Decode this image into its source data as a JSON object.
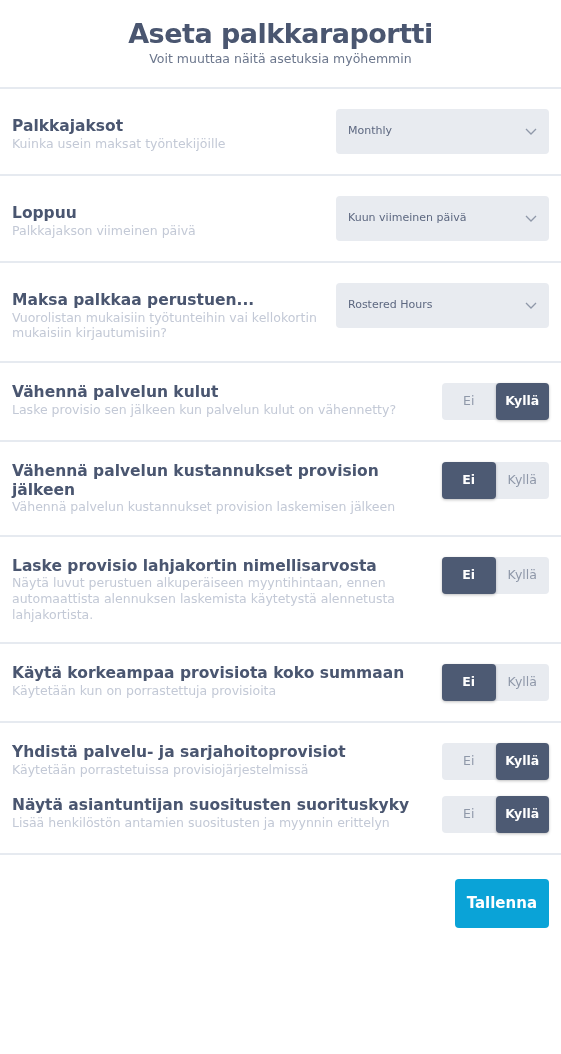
{
  "header": {
    "title": "Aseta palkkaraportti",
    "subtitle": "Voit muuttaa näitä asetuksia myöhemmin"
  },
  "sections": [
    {
      "settings": [
        {
          "kind": "select",
          "title": "Palkkajaksot",
          "description": "Kuinka usein maksat työntekijöille",
          "value": "Monthly"
        }
      ]
    },
    {
      "settings": [
        {
          "kind": "select",
          "title": "Loppuu",
          "description": "Palkkajakson viimeinen päivä",
          "value": "Kuun viimeinen päivä"
        }
      ]
    },
    {
      "settings": [
        {
          "kind": "select",
          "title": "Maksa palkkaa perustuen...",
          "description": "Vuorolistan mukaisiin työtunteihin vai kellokortin mukaisiin kirjautumisiin?",
          "value": "Rostered Hours"
        }
      ]
    },
    {
      "settings": [
        {
          "kind": "toggle",
          "title": "Vähennä palvelun kulut",
          "description": "Laske provisio sen jälkeen kun palvelun kulut on vähennetty?",
          "options": [
            {
              "label": "Ei",
              "selected": false
            },
            {
              "label": "Kyllä",
              "selected": true
            }
          ]
        }
      ]
    },
    {
      "settings": [
        {
          "kind": "toggle",
          "title": "Vähennä palvelun kustannukset provision jälkeen",
          "description": "Vähennä palvelun kustannukset provision laskemisen jälkeen",
          "options": [
            {
              "label": "Ei",
              "selected": true
            },
            {
              "label": "Kyllä",
              "selected": false
            }
          ]
        }
      ]
    },
    {
      "settings": [
        {
          "kind": "toggle",
          "title": "Laske provisio lahjakortin nimellisarvosta",
          "description": "Näytä luvut perustuen alkuperäiseen myyntihintaan, ennen automaattista alennuksen laskemista käytetystä alennetusta lahjakortista.",
          "options": [
            {
              "label": "Ei",
              "selected": true
            },
            {
              "label": "Kyllä",
              "selected": false
            }
          ]
        }
      ]
    },
    {
      "settings": [
        {
          "kind": "toggle",
          "title": "Käytä korkeampaa provisiota koko summaan",
          "description": "Käytetään kun on porrastettuja provisioita",
          "options": [
            {
              "label": "Ei",
              "selected": true
            },
            {
              "label": "Kyllä",
              "selected": false
            }
          ]
        }
      ]
    },
    {
      "settings": [
        {
          "kind": "toggle",
          "title": "Yhdistä palvelu- ja sarjahoitoprovisiot",
          "description": "Käytetään porrastetuissa provisiojärjestelmissä",
          "options": [
            {
              "label": "Ei",
              "selected": false
            },
            {
              "label": "Kyllä",
              "selected": true
            }
          ]
        },
        {
          "kind": "toggle",
          "title": "Näytä asiantuntijan suositusten suorituskyky",
          "description": "Lisää henkilöstön antamien suositusten ja myynnin erittelyn",
          "options": [
            {
              "label": "Ei",
              "selected": false
            },
            {
              "label": "Kyllä",
              "selected": true
            }
          ]
        }
      ]
    }
  ],
  "save_button": "Tallenna"
}
